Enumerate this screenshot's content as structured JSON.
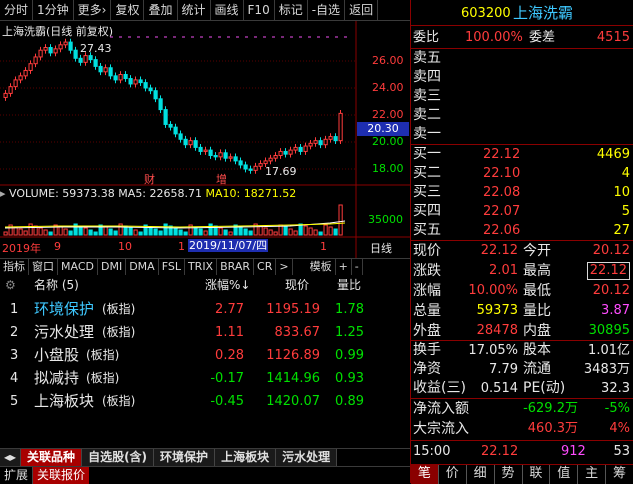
{
  "toolbar": {
    "items": [
      "分时",
      "1分钟",
      "更多›",
      "复权",
      "叠加",
      "统计",
      "画线",
      "F10",
      "标记",
      "-自选",
      "返回"
    ]
  },
  "chart": {
    "title": "上海洗霸(日线 前复权)",
    "high_label": "27.43",
    "low_label": "17.69",
    "marker_cai": "财",
    "marker_zeng": "增",
    "price_axis": [
      "26.00",
      "24.00",
      "22.00",
      "20.00",
      "18.00"
    ],
    "current_price": "20.30",
    "volume_line": {
      "vol": "VOLUME: 59373.38",
      "ma5": "MA5: 22658.71",
      "ma10": "MA10: 18271.52"
    },
    "volume_axis": "35000",
    "date_axis": [
      "2019年",
      "9",
      "10",
      "1",
      "2019/11/07/四",
      "1",
      "日线"
    ]
  },
  "indicator_tabs": [
    "指标",
    "窗口",
    "MACD",
    "DMI",
    "DMA",
    "FSL",
    "TRIX",
    "BRAR",
    "CR",
    ">",
    "模板",
    "+",
    "-"
  ],
  "related": {
    "header": {
      "name": "名称 (5)",
      "change": "涨幅%↓",
      "price": "现价",
      "ratio": "量比"
    },
    "rows": [
      {
        "num": "1",
        "name": "环境保护",
        "tag": "(板指)",
        "change": "2.77",
        "price": "1195.19",
        "ratio": "1.78"
      },
      {
        "num": "2",
        "name": "污水处理",
        "tag": "(板指)",
        "change": "1.11",
        "price": "833.67",
        "ratio": "1.25"
      },
      {
        "num": "3",
        "name": "小盘股",
        "tag": "(板指)",
        "change": "0.28",
        "price": "1126.89",
        "ratio": "0.99"
      },
      {
        "num": "4",
        "name": "拟减持",
        "tag": "(板指)",
        "change": "-0.17",
        "price": "1414.96",
        "ratio": "0.93"
      },
      {
        "num": "5",
        "name": "上海板块",
        "tag": "(板指)",
        "change": "-0.45",
        "price": "1420.07",
        "ratio": "0.89"
      }
    ]
  },
  "bottom_tabs": [
    "关联品种",
    "自选股(含)",
    "环境保护",
    "上海板块",
    "污水处理"
  ],
  "ext_tabs": [
    "扩展",
    "关联报价"
  ],
  "quote": {
    "code": "603200",
    "name": "上海洗霸",
    "weibi_label": "委比",
    "weibi": "100.00%",
    "weicha_label": "委差",
    "weicha": "4515",
    "sells": [
      {
        "label": "卖五"
      },
      {
        "label": "卖四"
      },
      {
        "label": "卖三"
      },
      {
        "label": "卖二"
      },
      {
        "label": "卖一"
      }
    ],
    "buys": [
      {
        "label": "买一",
        "price": "22.12",
        "vol": "4469"
      },
      {
        "label": "买二",
        "price": "22.10",
        "vol": "4"
      },
      {
        "label": "买三",
        "price": "22.08",
        "vol": "10"
      },
      {
        "label": "买四",
        "price": "22.07",
        "vol": "5"
      },
      {
        "label": "买五",
        "price": "22.06",
        "vol": "27"
      }
    ],
    "stats1": [
      {
        "l1": "现价",
        "v1": "22.12",
        "l2": "今开",
        "v2": "20.12"
      },
      {
        "l1": "涨跌",
        "v1": "2.01",
        "l2": "最高",
        "v2": "22.12"
      },
      {
        "l1": "涨幅",
        "v1": "10.00%",
        "l2": "最低",
        "v2": "20.12"
      },
      {
        "l1": "总量",
        "v1": "59373",
        "l2": "量比",
        "v2": "3.87"
      },
      {
        "l1": "外盘",
        "v1": "28478",
        "l2": "内盘",
        "v2": "30895"
      }
    ],
    "stats2": [
      {
        "l1": "换手",
        "v1": "17.05%",
        "l2": "股本",
        "v2": "1.01亿"
      },
      {
        "l1": "净资",
        "v1": "7.79",
        "l2": "流通",
        "v2": "3483万"
      },
      {
        "l1": "收益(三)",
        "v1": "0.514",
        "l2": "PE(动)",
        "v2": "32.3"
      }
    ],
    "flows": [
      {
        "label": "净流入额",
        "val": "-629.2万",
        "pct": "-5%"
      },
      {
        "label": "大宗流入",
        "val": "460.3万",
        "pct": "4%"
      }
    ],
    "tick": {
      "time": "15:00",
      "price": "22.12",
      "vol": "912",
      "n": "53"
    },
    "footer_tabs": [
      "笔",
      "价",
      "细",
      "势",
      "联",
      "值",
      "主",
      "筹"
    ]
  },
  "colors": {
    "up": "#ff3c3c",
    "down": "#00e000",
    "bg": "#000000",
    "border": "#8a0000"
  }
}
